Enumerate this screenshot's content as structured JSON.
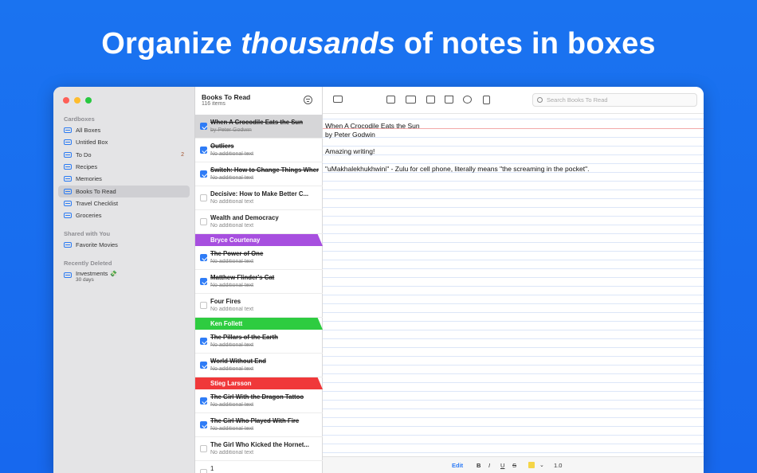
{
  "headline": {
    "pre": "Organize ",
    "emph": "thousands",
    "post": " of notes in boxes"
  },
  "sidebar": {
    "sections": {
      "cardboxes": "Cardboxes",
      "shared": "Shared with You",
      "deleted": "Recently Deleted"
    },
    "cardboxes": [
      {
        "label": "All Boxes"
      },
      {
        "label": "Untitled Box"
      },
      {
        "label": "To Do",
        "count": "2"
      },
      {
        "label": "Recipes"
      },
      {
        "label": "Memories"
      },
      {
        "label": "Books To Read"
      },
      {
        "label": "Travel Checklist"
      },
      {
        "label": "Groceries"
      }
    ],
    "shared": [
      {
        "label": "Favorite Movies"
      }
    ],
    "deleted": [
      {
        "label": "Investments 💸",
        "sub": "30 days"
      }
    ]
  },
  "list": {
    "title": "Books To Read",
    "count": "116 items",
    "items": [
      {
        "title": "When A Crocodile Eats the Sun",
        "sub": "by Peter Godwin",
        "done": true
      },
      {
        "title": "Outliers",
        "sub": "No additional text",
        "done": true
      },
      {
        "title": "Switch: How to Change Things When Change Is Hard",
        "sub": "No additional text",
        "done": true
      },
      {
        "title": "Decisive: How to Make Better C...",
        "sub": "No additional text",
        "done": false
      },
      {
        "title": "Wealth and Democracy",
        "sub": "No additional text",
        "done": false
      },
      {
        "title": "The Power of One",
        "sub": "No additional text",
        "done": true
      },
      {
        "title": "Matthew Flinder's Cat",
        "sub": "No additional text",
        "done": true
      },
      {
        "title": "Four Fires",
        "sub": "No additional text",
        "done": false
      },
      {
        "title": "The Pillars of the Earth",
        "sub": "No additional text",
        "done": true
      },
      {
        "title": "World Without End",
        "sub": "No additional text",
        "done": true
      },
      {
        "title": "The Girl With the Dragon Tattoo",
        "sub": "No additional text",
        "done": true
      },
      {
        "title": "The Girl Who Played With Fire",
        "sub": "No additional text",
        "done": true
      },
      {
        "title": "The Girl Who Kicked the Hornet...",
        "sub": "No additional text",
        "done": false
      },
      {
        "title": "1",
        "sub": "",
        "done": false
      }
    ],
    "groups": [
      {
        "label": "Bryce Courtenay",
        "color": "#a74fdf"
      },
      {
        "label": "Ken Follett",
        "color": "#2ecc40"
      },
      {
        "label": "Stieg Larsson",
        "color": "#f0383a"
      }
    ]
  },
  "search": {
    "placeholder": "Search Books To Read"
  },
  "note": {
    "lines": [
      "When A Crocodile Eats the Sun",
      "by Peter Godwin",
      "Amazing writing!",
      "\"uMakhalekhukhwini\" - Zulu for cell phone, literally means \"the screaming in the pocket\"."
    ]
  },
  "bottombar": {
    "edit": "Edit",
    "bold": "B",
    "italic": "I",
    "underline": "U",
    "strike": "S",
    "size": "1.0"
  }
}
